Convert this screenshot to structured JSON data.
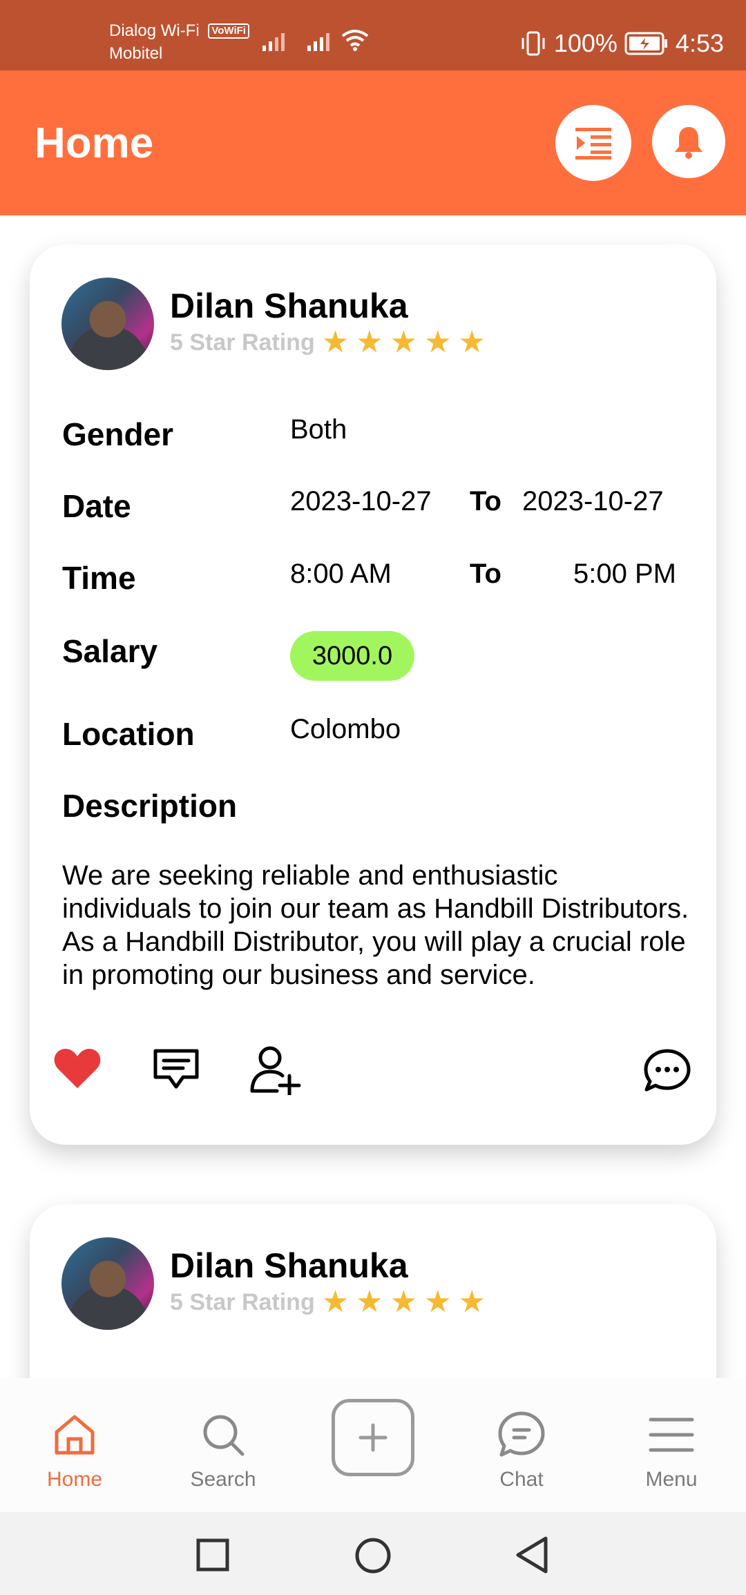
{
  "status_bar": {
    "carrier_line1": "Dialog Wi-Fi",
    "wifi_badge": "VoWiFi",
    "carrier_line2": "Mobitel",
    "battery": "100%",
    "time": "4:53"
  },
  "header": {
    "title": "Home",
    "accent_color": "#ff6f3d",
    "menu_icon": "indent-list-icon",
    "notification_icon": "bell-icon"
  },
  "cards": [
    {
      "name": "Dilan Shanuka",
      "rating_text": "5 Star Rating",
      "stars": 5,
      "fields": {
        "gender_label": "Gender",
        "gender_value": "Both",
        "date_label": "Date",
        "date_from": "2023-10-27",
        "date_to_word": "To",
        "date_to": "2023-10-27",
        "time_label": "Time",
        "time_from": "8:00 AM",
        "time_to_word": "To",
        "time_to": "5:00 PM",
        "salary_label": "Salary",
        "salary_value": "3000.0",
        "location_label": "Location",
        "location_value": "Colombo",
        "description_label": "Description",
        "description_text": "We are seeking reliable and enthusiastic individuals to join our team as Handbill Distributors. As a Handbill Distributor, you will play a crucial role in promoting our business and service."
      },
      "actions": [
        "heart-icon",
        "comment-icon",
        "add-user-icon",
        "chat-bubble-icon"
      ]
    },
    {
      "name": "Dilan Shanuka",
      "rating_text": "5 Star Rating",
      "stars": 5
    }
  ],
  "bottom_nav": {
    "items": [
      {
        "label": "Home",
        "icon": "home-icon",
        "active": true
      },
      {
        "label": "Search",
        "icon": "search-icon",
        "active": false
      },
      {
        "label": "",
        "icon": "add-icon",
        "active": false
      },
      {
        "label": "Chat",
        "icon": "chat-icon",
        "active": false
      },
      {
        "label": "Menu",
        "icon": "menu-icon",
        "active": false
      }
    ]
  },
  "system_nav": [
    "recents-icon",
    "home-circle-icon",
    "back-icon"
  ]
}
